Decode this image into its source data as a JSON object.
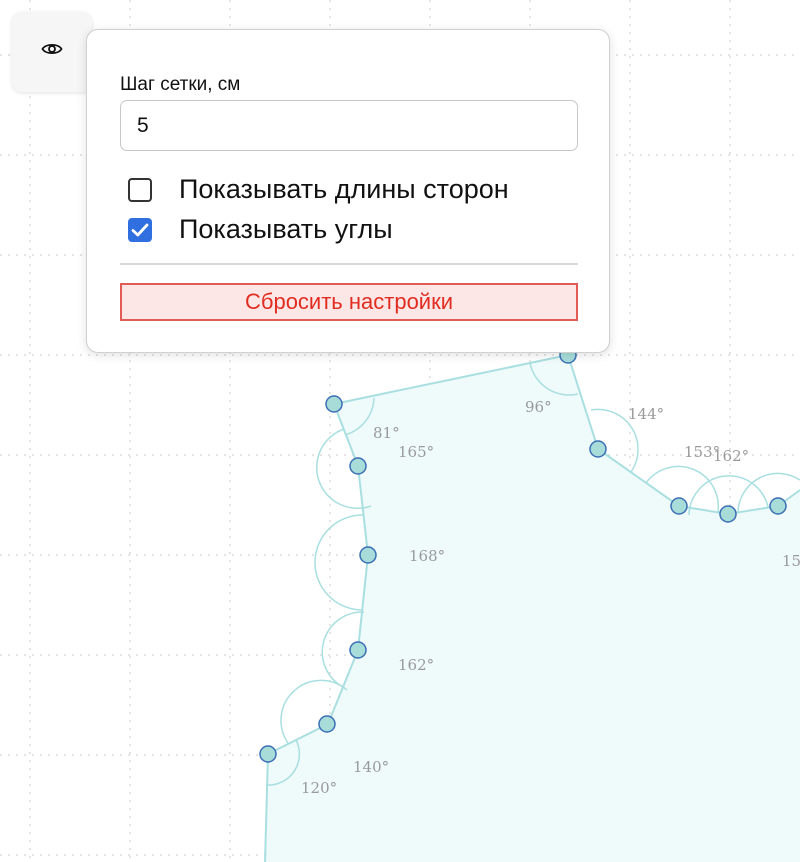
{
  "settings_panel": {
    "grid_step_label": "Шаг сетки, см",
    "grid_step_value": "5",
    "show_side_lengths": {
      "label": "Показывать длины сторон",
      "checked": false
    },
    "show_angles": {
      "label": "Показывать углы",
      "checked": true
    },
    "reset_button_label": "Сбросить настройки"
  },
  "toolbar": {
    "visibility_toggle_icon": "eye-icon"
  },
  "drawing": {
    "angle_labels": [
      "96°",
      "144°",
      "81°",
      "165°",
      "153°",
      "162°",
      "168°",
      "162°",
      "140°",
      "120°",
      "15"
    ]
  },
  "colors": {
    "accent": "#2f6fe0",
    "danger": "#e02d22",
    "danger_bg": "#fde6e6",
    "edge": "#a9dfe0",
    "vertex_fill": "#a8dcd9",
    "vertex_stroke": "#3a6fb5",
    "polygon_fill": "#effafa"
  }
}
